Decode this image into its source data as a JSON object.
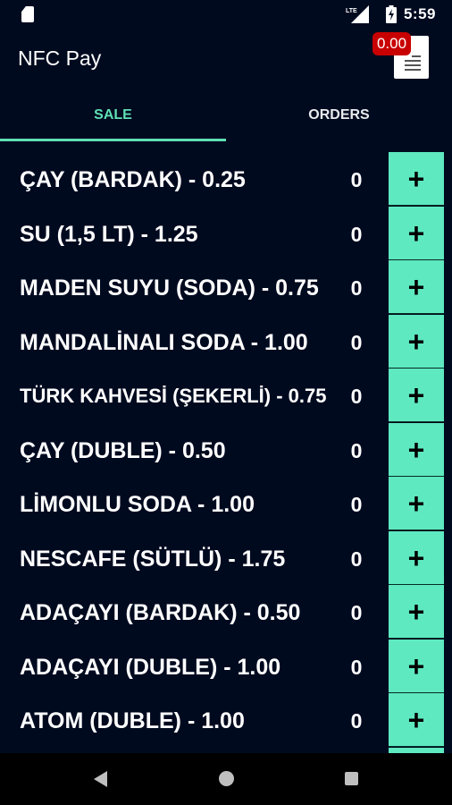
{
  "status_bar": {
    "network_label": "LTE",
    "time": "5:59"
  },
  "app_bar": {
    "title": "NFC Pay",
    "cart_total": "0.00",
    "cart_icon": "receipt-icon"
  },
  "tabs": [
    {
      "label": "SALE",
      "active": true
    },
    {
      "label": "ORDERS",
      "active": false
    }
  ],
  "items": [
    {
      "name": "ÇAY (BARDAK) - 0.25",
      "qty": "0",
      "button": "+"
    },
    {
      "name": "SU (1,5 LT) - 1.25",
      "qty": "0",
      "button": "+"
    },
    {
      "name": "MADEN SUYU (SODA) - 0.75",
      "qty": "0",
      "button": "+"
    },
    {
      "name": "MANDALİNALI SODA - 1.00",
      "qty": "0",
      "button": "+"
    },
    {
      "name": "TÜRK KAHVESİ (ŞEKERLİ) - 0.75",
      "qty": "0",
      "button": "+"
    },
    {
      "name": "ÇAY (DUBLE) - 0.50",
      "qty": "0",
      "button": "+"
    },
    {
      "name": "LİMONLU SODA - 1.00",
      "qty": "0",
      "button": "+"
    },
    {
      "name": "NESCAFE (SÜTLÜ) - 1.75",
      "qty": "0",
      "button": "+"
    },
    {
      "name": "ADAÇAYI (BARDAK) - 0.50",
      "qty": "0",
      "button": "+"
    },
    {
      "name": "ADAÇAYI (DUBLE) - 1.00",
      "qty": "0",
      "button": "+"
    },
    {
      "name": "ATOM (DUBLE) - 1.00",
      "qty": "0",
      "button": "+"
    }
  ],
  "colors": {
    "background": "#000a1f",
    "accent": "#5ee0b4",
    "add_button": "#5ee9c0",
    "badge": "#c90000"
  },
  "nav_bar": {
    "back_icon": "back-triangle-icon",
    "home_icon": "home-circle-icon",
    "recents_icon": "recents-square-icon"
  }
}
